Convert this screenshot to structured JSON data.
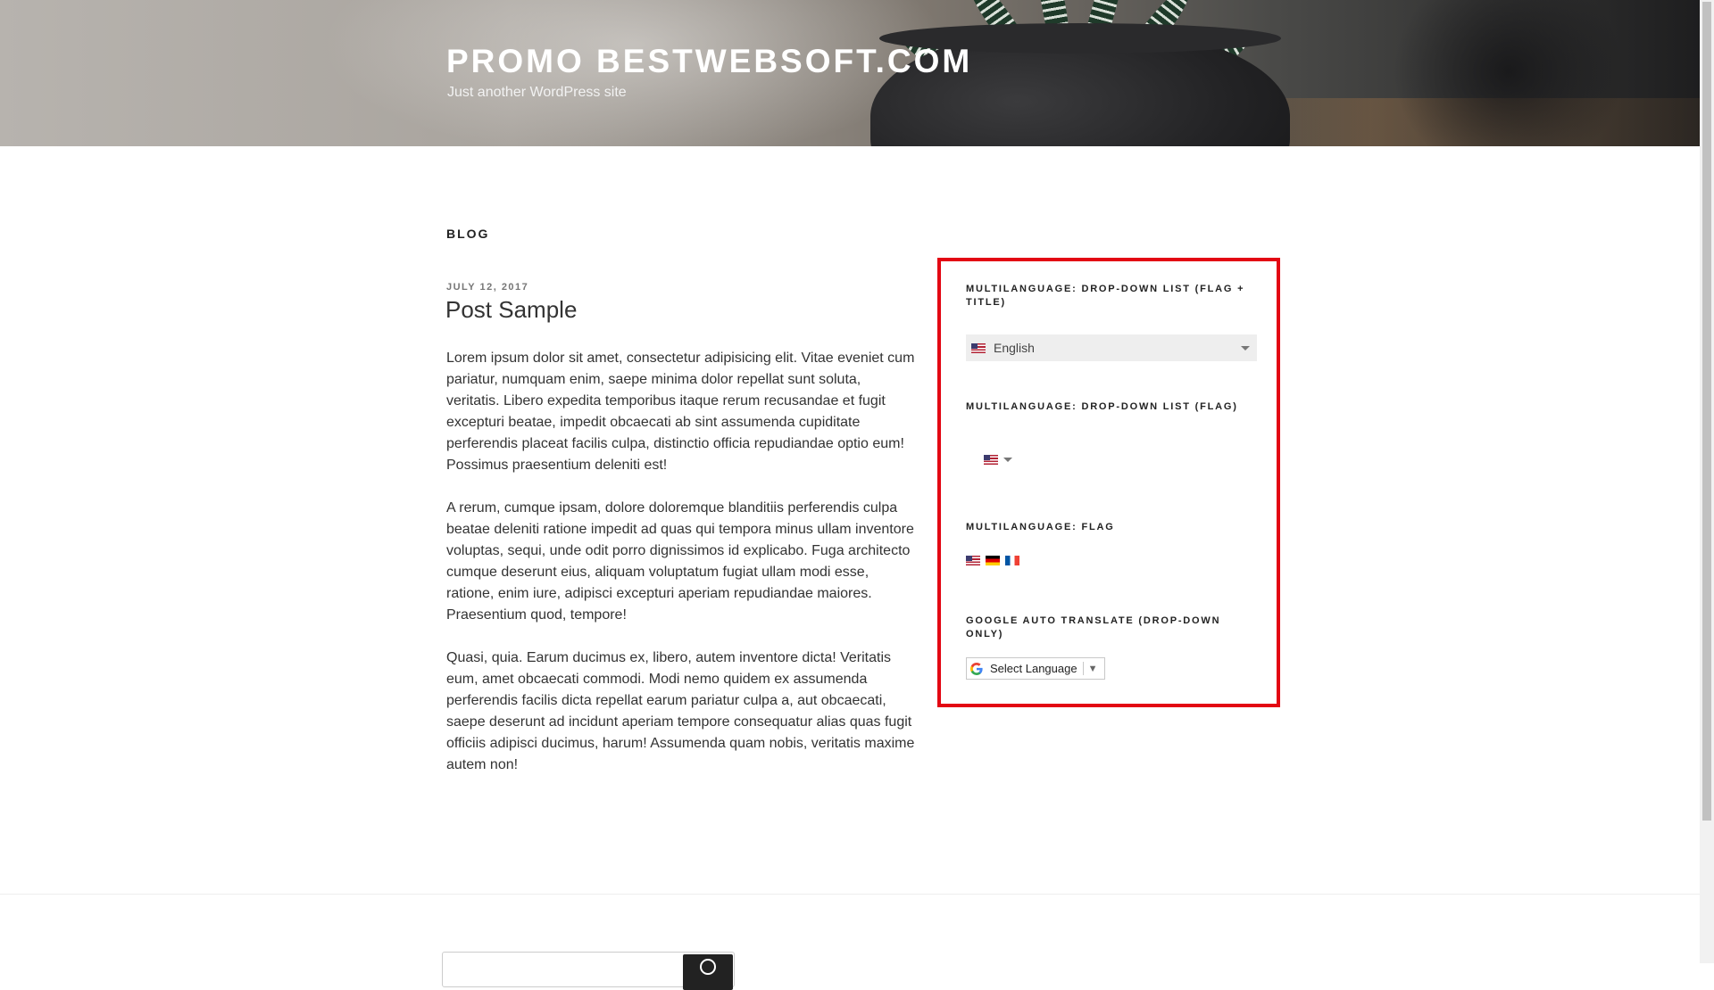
{
  "header": {
    "site_title": "PROMO BESTWEBSOFT.COM",
    "site_description": "Just another WordPress site"
  },
  "main": {
    "page_heading": "BLOG",
    "post": {
      "date": "JULY 12, 2017",
      "title": "Post Sample",
      "paragraphs": [
        "Lorem ipsum dolor sit amet, consectetur adipisicing elit. Vitae eveniet cum pariatur, numquam enim, saepe minima dolor repellat sunt soluta, veritatis. Libero expedita temporibus itaque rerum recusandae et fugit excepturi beatae, impedit obcaecati ab sint assumenda cupiditate perferendis placeat facilis culpa, distinctio officia repudiandae optio eum! Possimus praesentium deleniti est!",
        "A rerum, cumque ipsam, dolore doloremque blanditiis perferendis culpa beatae deleniti ratione impedit ad quas qui tempora minus ullam inventore voluptas, sequi, unde odit porro dignissimos id explicabo. Fuga architecto cumque deserunt eius, aliquam voluptatum fugiat ullam modi esse, ratione, enim iure, adipisci excepturi aperiam repudiandae maiores. Praesentium quod, tempore!",
        "Quasi, quia. Earum ducimus ex, libero, autem inventore dicta! Veritatis eum, amet obcaecati commodi. Modi nemo quidem ex assumenda perferendis facilis dicta repellat earum pariatur culpa a, aut obcaecati, saepe deserunt ad incidunt aperiam tempore consequatur alias quas fugit officiis adipisci ducimus, harum! Assumenda quam nobis, veritatis maxime autem non!"
      ]
    }
  },
  "sidebar": {
    "widgets": [
      {
        "title": "MULTILANGUAGE: DROP-DOWN LIST (FLAG + TITLE)",
        "selected_language": "English",
        "flag_icon": "flag-us-icon"
      },
      {
        "title": "MULTILANGUAGE: DROP-DOWN LIST (FLAG)",
        "flag_icon": "flag-us-icon"
      },
      {
        "title": "MULTILANGUAGE: FLAG",
        "flags": [
          "flag-us-icon",
          "flag-de-icon",
          "flag-fr-icon"
        ]
      },
      {
        "title": "GOOGLE AUTO TRANSLATE (DROP-DOWN ONLY)",
        "select_label": "Select Language",
        "arrow": "▼"
      }
    ],
    "highlight_color": "#e30613"
  }
}
